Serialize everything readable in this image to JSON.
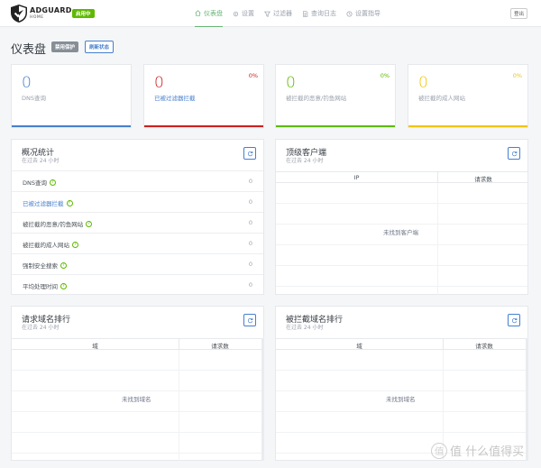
{
  "header": {
    "brand": "ADGUARD",
    "brand_sub": "HOME",
    "status_badge": "启用中",
    "logout": "登出",
    "nav": [
      {
        "label": "仪表盘",
        "icon": "home-icon",
        "active": true
      },
      {
        "label": "设置",
        "icon": "gear-icon",
        "active": false
      },
      {
        "label": "过滤器",
        "icon": "filter-icon",
        "active": false
      },
      {
        "label": "查询日志",
        "icon": "document-icon",
        "active": false
      },
      {
        "label": "设置指导",
        "icon": "clock-icon",
        "active": false
      }
    ]
  },
  "page": {
    "title": "仪表盘",
    "disable_protection": "禁用保护",
    "refresh_stats": "刷新状态"
  },
  "stat_cards": [
    {
      "value": "0",
      "label": "DNS查询",
      "percent": "",
      "color": "#467fcf"
    },
    {
      "value": "0",
      "label": "已被过滤器拦截",
      "percent": "0%",
      "color": "#cd201f"
    },
    {
      "value": "0",
      "label": "被拦截的恶意/钓鱼网站",
      "percent": "0%",
      "color": "#5eba00"
    },
    {
      "value": "0",
      "label": "被拦截的成人网站",
      "percent": "0%",
      "color": "#f1c40f"
    }
  ],
  "overview": {
    "title": "概况统计",
    "subtitle": "在过去 24 小时",
    "rows": [
      {
        "label": "DNS查询",
        "value": "0",
        "link": false
      },
      {
        "label": "已被过滤器拦截",
        "value": "0",
        "link": true
      },
      {
        "label": "被拦截的恶意/钓鱼网站",
        "value": "0",
        "link": false
      },
      {
        "label": "被拦截的成人网站",
        "value": "0",
        "link": false
      },
      {
        "label": "强制安全搜索",
        "value": "0",
        "link": false
      },
      {
        "label": "平均处理时间",
        "value": "0",
        "link": false
      }
    ]
  },
  "top_clients": {
    "title": "顶级客户端",
    "subtitle": "在过去 24 小时",
    "col1": "IP",
    "col2": "请求数",
    "empty": "未找到客户端"
  },
  "top_domains": {
    "title": "请求域名排行",
    "subtitle": "在过去 24 小时",
    "col1": "域",
    "col2": "请求数",
    "empty": "未找到域名"
  },
  "blocked_domains": {
    "title": "被拦截域名排行",
    "subtitle": "在过去 24 小时",
    "col1": "域",
    "col2": "请求数",
    "empty": "未找到域名"
  },
  "watermark": "值 什么值得买",
  "colors": {
    "accent_green": "#66b574",
    "primary_blue": "#467fcf",
    "red": "#cd201f",
    "green": "#5eba00",
    "yellow": "#f1c40f"
  }
}
